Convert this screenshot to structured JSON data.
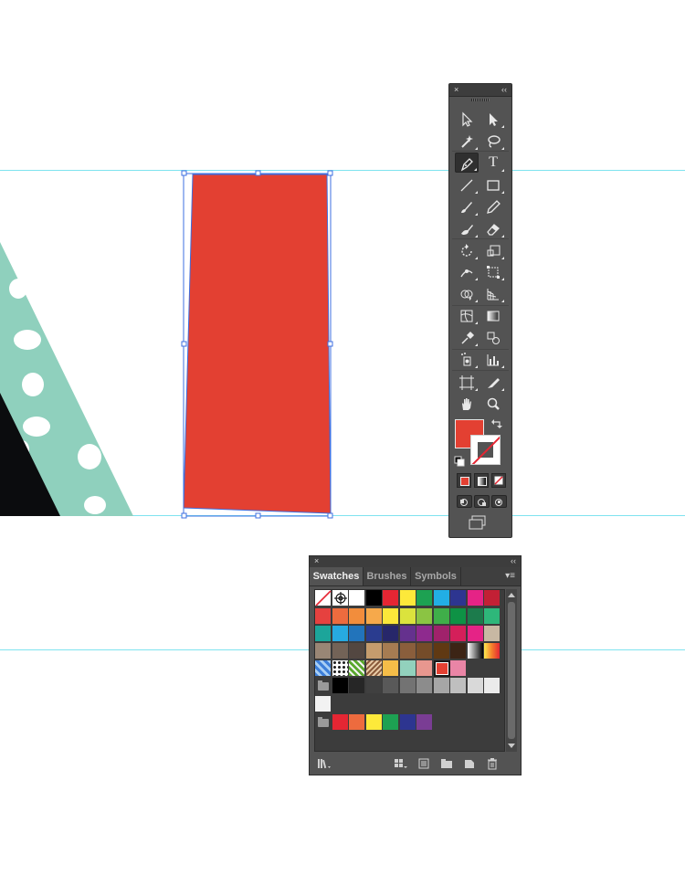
{
  "tools_panel": {
    "close_glyph": "×",
    "collapse_glyph": "‹‹",
    "fill_color": "#e34032",
    "stroke_color": "none",
    "tools": [
      {
        "name": "selection-icon"
      },
      {
        "name": "direct-selection-icon"
      },
      {
        "name": "magic-wand-icon"
      },
      {
        "name": "lasso-icon"
      },
      {
        "name": "pen-icon"
      },
      {
        "name": "type-icon",
        "glyph": "T"
      },
      {
        "name": "line-segment-icon"
      },
      {
        "name": "rectangle-icon"
      },
      {
        "name": "paintbrush-icon"
      },
      {
        "name": "pencil-icon"
      },
      {
        "name": "blob-brush-icon"
      },
      {
        "name": "eraser-icon"
      },
      {
        "name": "rotate-icon"
      },
      {
        "name": "scale-icon"
      },
      {
        "name": "width-icon"
      },
      {
        "name": "free-transform-icon"
      },
      {
        "name": "shape-builder-icon"
      },
      {
        "name": "perspective-grid-icon"
      },
      {
        "name": "mesh-icon"
      },
      {
        "name": "gradient-icon"
      },
      {
        "name": "eyedropper-icon"
      },
      {
        "name": "blend-icon"
      },
      {
        "name": "symbol-sprayer-icon"
      },
      {
        "name": "column-graph-icon"
      },
      {
        "name": "artboard-icon"
      },
      {
        "name": "slice-icon"
      },
      {
        "name": "hand-icon"
      },
      {
        "name": "zoom-icon"
      }
    ]
  },
  "swatches_panel": {
    "close_glyph": "×",
    "collapse_glyph": "‹‹",
    "tabs": [
      "Swatches",
      "Brushes",
      "Symbols"
    ],
    "active_tab": "Swatches",
    "rows": [
      [
        "none",
        "registration",
        "#ffffff",
        "#000000",
        "#e52633",
        "#fde93a",
        "#1da152",
        "#22aee5",
        "#2d3590",
        "#e52386",
        "#c22035"
      ],
      [
        "#e6413f",
        "#ed6b3e",
        "#f28d3c",
        "#f6a94b",
        "#fbe73a",
        "#dbe33d",
        "#8bc443",
        "#3fae49",
        "#0e9245",
        "#1c7b4c",
        "#2eb77a"
      ],
      [
        "#1ca59a",
        "#27aae1",
        "#2274bb",
        "#2a3c8f",
        "#27276a",
        "#65318e",
        "#8e2a8e",
        "#a0226b",
        "#d41f5a",
        "#e52386",
        "#c8b8a3"
      ],
      [
        "#998675",
        "#736357",
        "#534741",
        "#c59c6d",
        "#a67c52",
        "#8a5e3c",
        "#754c29",
        "#603913",
        "#3c2415",
        "grad-bw",
        "grad-orange"
      ],
      [
        "pat-blue",
        "pat-dots",
        "pat-green",
        "pat-brown",
        "#f5bd48",
        "#92d1bd",
        "#e8978f",
        "#e34032",
        "#ea85a6"
      ],
      [
        "folder",
        "#000000",
        "#262626",
        "#404040",
        "#595959",
        "#737373",
        "#8c8c8c",
        "#a6a6a6",
        "#bfbfbf",
        "#d9d9d9",
        "#ebebeb"
      ],
      [
        "#f2f2f2"
      ],
      [
        "folder",
        "#e52633",
        "#ed6b3e",
        "#fde93a",
        "#1da152",
        "#2d3590",
        "#7a3d94"
      ]
    ],
    "selected_color": "#e34032"
  },
  "artwork": {
    "shape_fill": "#e34032",
    "triangle_fill": "#8fd0bd",
    "black_fill": "#0b0c0e",
    "guide_color": "#7fe3ef"
  }
}
